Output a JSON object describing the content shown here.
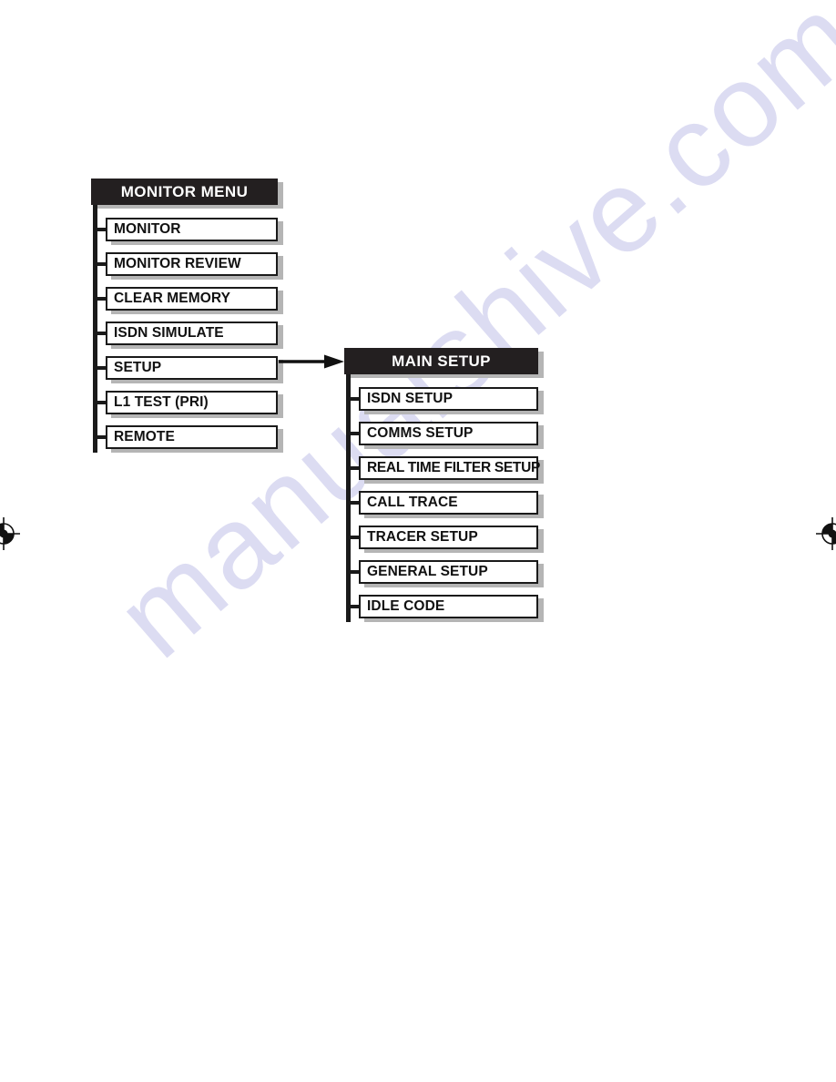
{
  "page": {
    "watermark_text": "manualshive.com",
    "colors": {
      "header_bg": "#231f20",
      "header_text": "#ffffff",
      "box_border": "#1a1a1a",
      "box_bg": "#ffffff",
      "shadow": "#b5b5b5",
      "watermark": "#dcdcf2",
      "label_text": "#111111"
    }
  },
  "monitor_menu": {
    "title": "MONITOR MENU",
    "items": [
      {
        "label": "MONITOR"
      },
      {
        "label": "MONITOR REVIEW"
      },
      {
        "label": "CLEAR MEMORY"
      },
      {
        "label": "ISDN SIMULATE"
      },
      {
        "label": "SETUP"
      },
      {
        "label": "L1 TEST (PRI)"
      },
      {
        "label": "REMOTE"
      }
    ]
  },
  "main_setup": {
    "title": "MAIN SETUP",
    "items": [
      {
        "label": "ISDN SETUP"
      },
      {
        "label": "COMMS SETUP"
      },
      {
        "label": "REAL TIME FILTER SETUP"
      },
      {
        "label": "CALL TRACE"
      },
      {
        "label": "TRACER SETUP"
      },
      {
        "label": "GENERAL SETUP"
      },
      {
        "label": "IDLE CODE"
      }
    ]
  },
  "connector": {
    "from": "SETUP",
    "to": "MAIN SETUP",
    "icon": "arrow-right-icon"
  },
  "registration_marks": {
    "left": "registration-mark-icon",
    "right": "registration-mark-icon"
  }
}
